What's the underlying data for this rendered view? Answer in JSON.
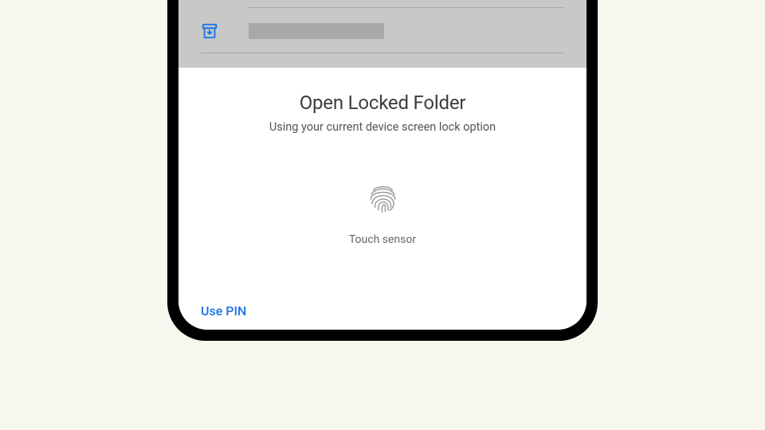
{
  "auth": {
    "title": "Open Locked Folder",
    "subtitle": "Using your current device screen lock option",
    "sensor_label": "Touch sensor",
    "use_pin_label": "Use PIN"
  },
  "icons": {
    "archive": "archive-box",
    "fingerprint": "fingerprint"
  },
  "colors": {
    "accent": "#1a73e8"
  }
}
